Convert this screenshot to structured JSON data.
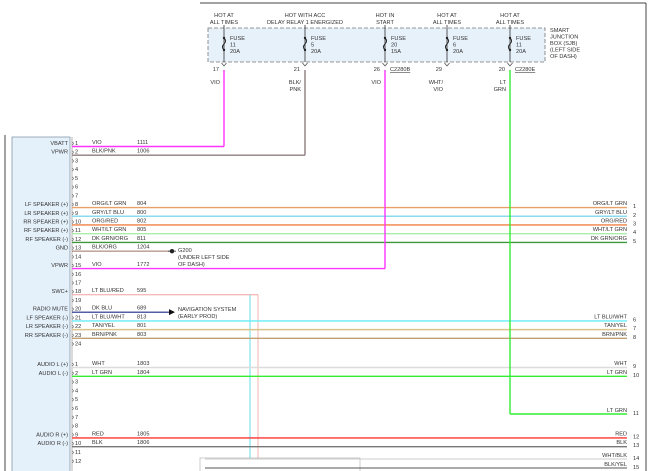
{
  "sjb": {
    "label": [
      "SMART",
      "JUNCTION",
      "BOX (SJB)",
      "(LEFT SIDE",
      "OF DASH)"
    ],
    "fuses": [
      {
        "feed": [
          "HOT AT",
          "ALL TIMES"
        ],
        "fuse": [
          "FUSE",
          "11",
          "20A"
        ],
        "pin": "17",
        "wire": [
          "VIO"
        ],
        "color": "#ff33ff"
      },
      {
        "feed": [
          "HOT WITH ACC",
          "DELAY RELAY 1 ENERGIZED"
        ],
        "fuse": [
          "FUSE",
          "5",
          "20A"
        ],
        "pin": "21",
        "wire": [
          "BLK/",
          "PNK"
        ],
        "color": "#8c7d7d"
      },
      {
        "feed": [
          "HOT IN",
          "START"
        ],
        "fuse": [
          "FUSE",
          "20",
          "15A"
        ],
        "pin": "26",
        "wire": [
          "VIO"
        ],
        "color": "#ff33ff",
        "connector": "C2280B"
      },
      {
        "feed": [
          "HOT AT",
          "ALL TIMES"
        ],
        "fuse": [
          "FUSE",
          "6",
          "20A"
        ],
        "pin": "29",
        "wire": [
          "WHT/",
          "VIO"
        ],
        "color": "#ffaaff"
      },
      {
        "feed": [
          "HOT AT",
          "ALL TIMES"
        ],
        "fuse": [
          "FUSE",
          "11",
          "20A"
        ],
        "pin": "20",
        "wire": [
          "LT",
          "GRN"
        ],
        "color": "#33ee33",
        "connector": "C2280E"
      }
    ]
  },
  "radio": {
    "pins": [
      {
        "pin": "1",
        "label": "VBATT",
        "wire": "VIO",
        "circuit": "1111",
        "color": "#ff33ff",
        "to": "fuse0"
      },
      {
        "pin": "2",
        "label": "VPWR",
        "wire": "BLK/PNK",
        "circuit": "1006",
        "color": "#8c7d7d",
        "to": "fuse1"
      },
      {
        "pin": "3"
      },
      {
        "pin": "4"
      },
      {
        "pin": "5"
      },
      {
        "pin": "6"
      },
      {
        "pin": "7"
      },
      {
        "pin": "8",
        "label": "LF SPEAKER (+)",
        "wire": "ORG/LT GRN",
        "circuit": "804",
        "color": "#e8a068",
        "to": "right",
        "right_label": "ORG/LT GRN",
        "right_pin": "1"
      },
      {
        "pin": "9",
        "label": "LR SPEAKER (+)",
        "wire": "GRY/LT BLU",
        "circuit": "800",
        "color": "#88dcee",
        "to": "right",
        "right_label": "GRY/LT BLU",
        "right_pin": "2"
      },
      {
        "pin": "10",
        "label": "RR SPEAKER (+)",
        "wire": "ORG/RED",
        "circuit": "802",
        "color": "#f08040",
        "to": "right",
        "right_label": "ORG/RED",
        "right_pin": "3"
      },
      {
        "pin": "11",
        "label": "RF SPEAKER (+)",
        "wire": "WHT/LT GRN",
        "circuit": "805",
        "color": "#a8eea8",
        "to": "right",
        "right_label": "WHT/LT GRN",
        "right_pin": "4"
      },
      {
        "pin": "12",
        "label": "RF SPEAKER (-)",
        "wire": "DK GRN/ORG",
        "circuit": "811",
        "color": "#3a9a3a",
        "to": "right",
        "right_label": "DK GRN/ORG",
        "right_pin": "5"
      },
      {
        "pin": "13",
        "label": "GND",
        "wire": "BLK/ORG",
        "circuit": "1204",
        "color": "#9a7060",
        "to": "ground",
        "note": [
          "G200",
          "(UNDER LEFT SIDE",
          "OF DASH)"
        ]
      },
      {
        "pin": "14"
      },
      {
        "pin": "15",
        "label": "VPWR",
        "wire": "VIO",
        "circuit": "1772",
        "color": "#ff33ff",
        "to": "fuse2"
      },
      {
        "pin": "16"
      },
      {
        "pin": "17"
      },
      {
        "pin": "18",
        "label": "SWC+",
        "wire": "LT BLU/RED",
        "circuit": "595",
        "color": "#f4a0a0",
        "to": "swc"
      },
      {
        "pin": "19"
      },
      {
        "pin": "20",
        "label": "RADIO MUTE",
        "wire": "DK BLU",
        "circuit": "689",
        "color": "#1a2a8a",
        "to": "arrow",
        "note": [
          "NAVIGATION SYSTEM",
          "(EARLY PROD)"
        ]
      },
      {
        "pin": "21",
        "label": "LF SPEAKER (-)",
        "wire": "LT BLU/WHT",
        "circuit": "813",
        "color": "#66eef8",
        "to": "right",
        "right_label": "LT BLU/WHT",
        "right_pin": "6"
      },
      {
        "pin": "22",
        "label": "LR SPEAKER (-)",
        "wire": "TAN/YEL",
        "circuit": "801",
        "color": "#d8c488",
        "to": "right",
        "right_label": "TAN/YEL",
        "right_pin": "7"
      },
      {
        "pin": "23",
        "label": "RR SPEAKER (-)",
        "wire": "BRN/PNK",
        "circuit": "803",
        "color": "#c0a070",
        "to": "right",
        "right_label": "BRN/PNK",
        "right_pin": "8"
      },
      {
        "pin": "24"
      }
    ],
    "pins2": [
      {
        "pin": "1",
        "label": "AUDIO L (+)",
        "wire": "WHT",
        "circuit": "1803",
        "color": "#dcdcdc",
        "to": "right",
        "right_label": "WHT",
        "right_pin": "9"
      },
      {
        "pin": "2",
        "label": "AUDIO L (-)",
        "wire": "LT GRN",
        "circuit": "1804",
        "color": "#33ee33",
        "to": "right",
        "right_label": "LT GRN",
        "right_pin": "10"
      },
      {
        "pin": "3"
      },
      {
        "pin": "4"
      },
      {
        "pin": "5"
      },
      {
        "pin": "6"
      },
      {
        "pin": "7"
      },
      {
        "pin": "8"
      },
      {
        "pin": "9",
        "label": "AUDIO R (+)",
        "wire": "RED",
        "circuit": "1805",
        "color": "#ff3333",
        "to": "right",
        "right_label": "RED",
        "right_pin": "12"
      },
      {
        "pin": "10",
        "label": "AUDIO R (-)",
        "wire": "BLK",
        "circuit": "1806",
        "color": "#777777",
        "to": "right",
        "right_label": "BLK",
        "right_pin": "13"
      },
      {
        "pin": "11"
      },
      {
        "pin": "12"
      }
    ]
  },
  "right_extra": [
    {
      "right_label": "LT GRN",
      "right_pin": "11",
      "color": "#33ee33"
    },
    {
      "right_label": "WHT/BLK",
      "right_pin": "14",
      "color": "#cccccc"
    },
    {
      "right_label": "BLK/YEL",
      "right_pin": "15",
      "color": "#555555"
    }
  ]
}
